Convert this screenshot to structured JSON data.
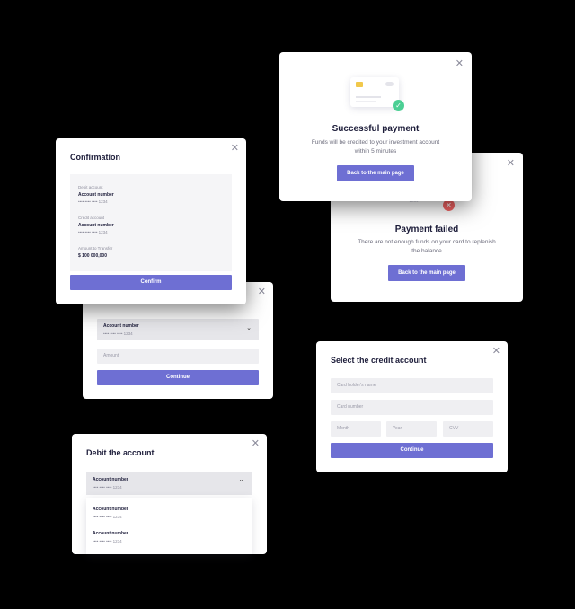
{
  "confirmation": {
    "title": "Confirmation",
    "debit_label": "Debit account",
    "debit_account_title": "Account number",
    "debit_account_mask": "•••• •••• •••• 1234",
    "credit_label": "Credit account",
    "credit_account_title": "Account number",
    "credit_account_mask": "•••• •••• •••• 1234",
    "amount_label": "Amount to Transfer",
    "amount_value": "$ 100 000,000",
    "confirm_label": "Confirm"
  },
  "transfer_form": {
    "account_title": "Account number",
    "account_mask": "•••• •••• •••• 1234",
    "amount_placeholder": "Amount",
    "continue_label": "Continue"
  },
  "success": {
    "title": "Successful payment",
    "description": "Funds will be credited to your investment account within 5 minutes",
    "button_label": "Back to the main page"
  },
  "failed": {
    "title": "Payment failed",
    "description": "There are not enough funds on your card to replenish the balance",
    "button_label": "Back to the main page"
  },
  "credit_account": {
    "title": "Select the credit account",
    "holder_placeholder": "Card holder's name",
    "number_placeholder": "Card number",
    "month_placeholder": "Month",
    "year_placeholder": "Year",
    "cvv_placeholder": "CVV",
    "continue_label": "Continue"
  },
  "debit_account": {
    "title": "Debit the account",
    "selected_title": "Account number",
    "selected_mask": "•••• •••• •••• 1234",
    "options": [
      {
        "title": "Account number",
        "mask": "•••• •••• •••• 1234"
      },
      {
        "title": "Account number",
        "mask": "•••• •••• •••• 1234"
      }
    ]
  },
  "icons": {
    "close": "close-icon",
    "chevron": "chevron-down-icon",
    "check": "check-icon",
    "error": "x-icon"
  },
  "colors": {
    "accent": "#6e6fd3",
    "success": "#4ccf94",
    "error": "#f26363",
    "chip": "#f1c84b"
  }
}
